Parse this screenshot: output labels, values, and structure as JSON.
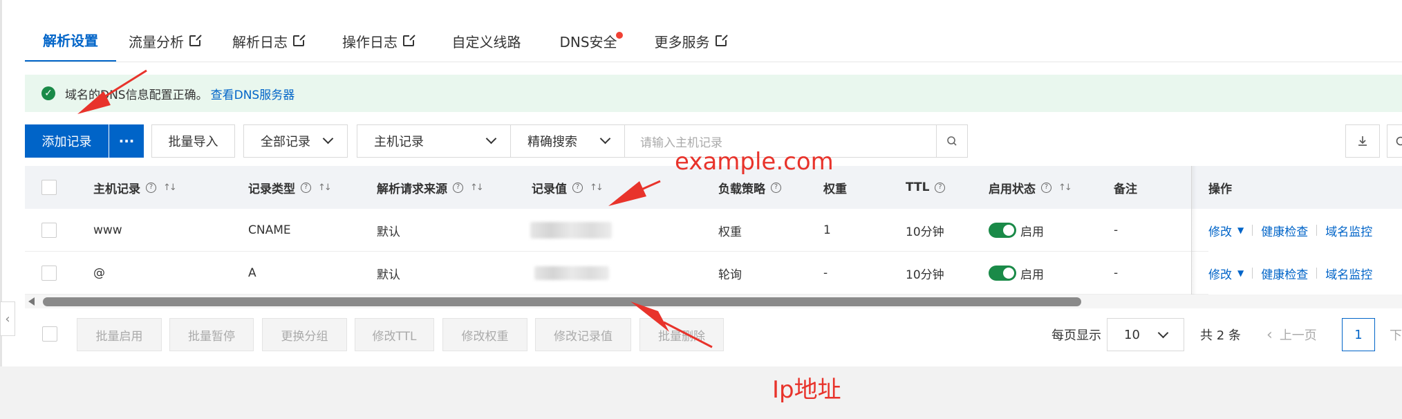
{
  "tabs": [
    {
      "label": "解析设置"
    },
    {
      "label": "流量分析"
    },
    {
      "label": "解析日志"
    },
    {
      "label": "操作日志"
    },
    {
      "label": "自定义线路"
    },
    {
      "label": "DNS安全"
    },
    {
      "label": "更多服务"
    }
  ],
  "notice": {
    "text": "域名的DNS信息配置正确。",
    "link": "查看DNS服务器"
  },
  "toolbar": {
    "add_label": "添加记录",
    "more_label": "···",
    "import_label": "批量导入",
    "filter_all": "全部记录",
    "field_select": "主机记录",
    "match_select": "精确搜索",
    "search_placeholder": "请输入主机记录"
  },
  "table": {
    "headers": {
      "host": "主机记录",
      "type": "记录类型",
      "source": "解析请求来源",
      "value": "记录值",
      "policy": "负载策略",
      "weight": "权重",
      "ttl": "TTL",
      "status": "启用状态",
      "remark": "备注",
      "ops": "操作"
    },
    "rows": [
      {
        "host": "www",
        "type": "CNAME",
        "source": "默认",
        "policy": "权重",
        "weight": "1",
        "ttl": "10分钟",
        "status": "启用",
        "remark": "-",
        "edit": "修改",
        "health": "健康检查",
        "monitor": "域名监控"
      },
      {
        "host": "@",
        "type": "A",
        "source": "默认",
        "policy": "轮询",
        "weight": "-",
        "ttl": "10分钟",
        "status": "启用",
        "remark": "-",
        "edit": "修改",
        "health": "健康检查",
        "monitor": "域名监控"
      }
    ]
  },
  "batch": {
    "enable": "批量启用",
    "pause": "批量暂停",
    "group": "更换分组",
    "ttl": "修改TTL",
    "weight": "修改权重",
    "value": "修改记录值",
    "delete": "批量删除"
  },
  "pager": {
    "per_page_label": "每页显示",
    "per_page": "10",
    "total": "共 2 条",
    "prev": "上一页",
    "current": "1",
    "next": "下"
  },
  "annotations": {
    "example": "example.com",
    "ip": "Ip地址"
  },
  "colors": {
    "primary": "#0064c8",
    "success": "#1a8a48",
    "annotation": "#e8332b"
  }
}
